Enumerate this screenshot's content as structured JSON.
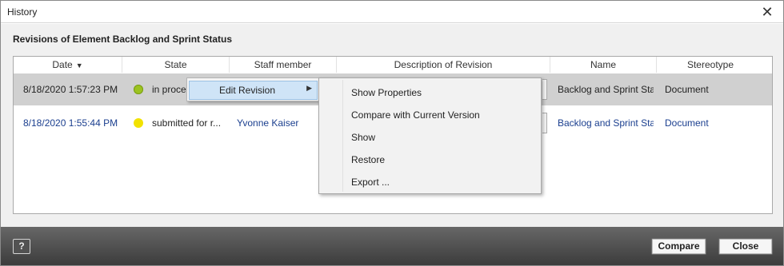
{
  "window": {
    "title": "History"
  },
  "heading": "Revisions of Element Backlog and Sprint Status",
  "columns": [
    "Date",
    "State",
    "Staff member",
    "Description of Revision",
    "Name",
    "Stereotype"
  ],
  "rows": [
    {
      "date": "8/18/2020 1:57:23 PM",
      "state": "in proce",
      "state_color": "#9cc321",
      "staff": "",
      "description": "",
      "name": "Backlog and Sprint Stat",
      "stereotype": "Document"
    },
    {
      "date": "8/18/2020 1:55:44 PM",
      "state": "submitted for r...",
      "state_color": "#f2e200",
      "staff": "Yvonne Kaiser",
      "description": "",
      "name": "Backlog and Sprint Stat",
      "stereotype": "Document"
    }
  ],
  "context_menu": {
    "item": "Edit Revision",
    "submenu": [
      "Show Properties",
      "Compare with Current Version",
      "Show",
      "Restore",
      "Export ..."
    ]
  },
  "footer": {
    "help_label": "?",
    "compare_label": "Compare",
    "close_label": "Close"
  },
  "colors": {
    "link": "#1b3f8f",
    "selected_row": "#d0d0d0",
    "footer_dark": "#3c3c3c"
  }
}
